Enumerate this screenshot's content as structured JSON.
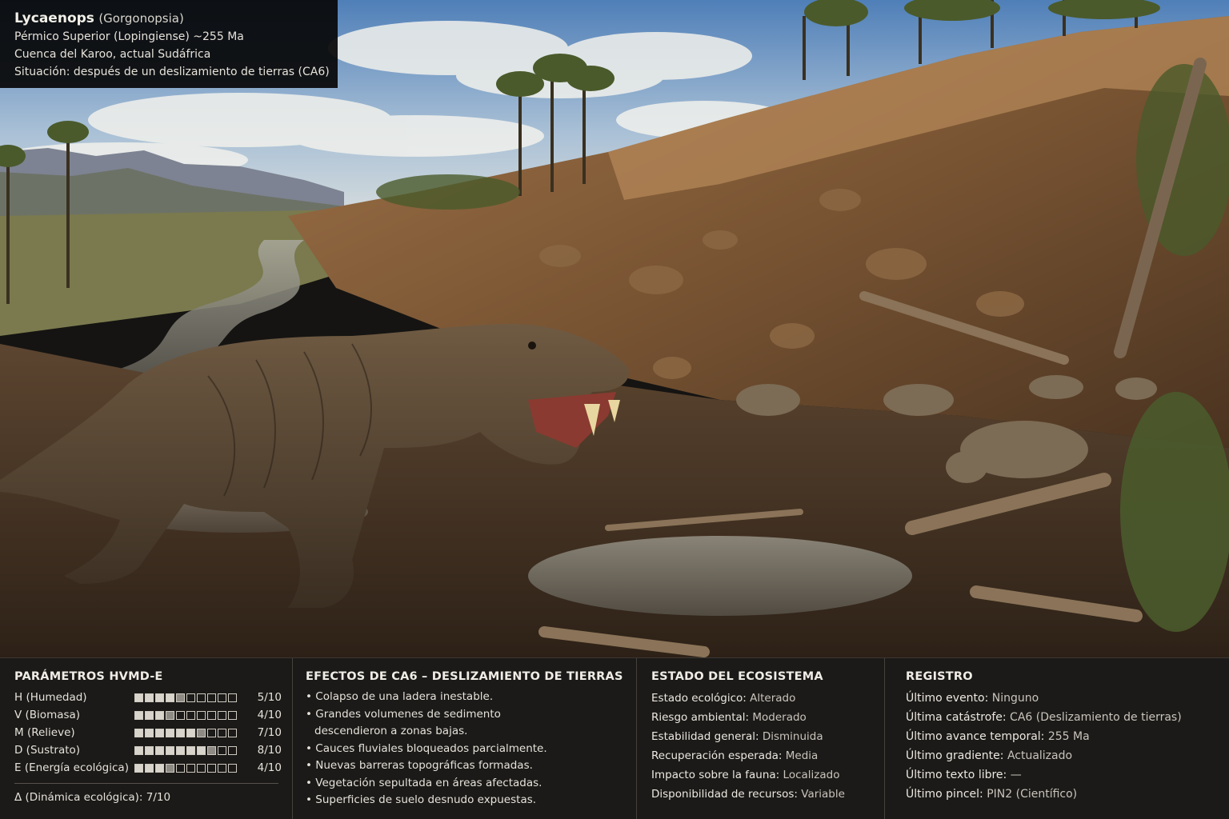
{
  "scene": {
    "colors": {
      "sky_top": "#5d89bf",
      "sky_low": "#c9d6e0",
      "earth": "#6a4a2e",
      "mud": "#3b2b1d",
      "vegetation": "#4b5a2a",
      "water": "#8c8a80"
    }
  },
  "info": {
    "name": "Lycaenops",
    "group": "(Gorgonopsia)",
    "period": "Pérmico Superior (Lopingiense) ~255 Ma",
    "location": "Cuenca del Karoo, actual Sudáfrica",
    "situation": "Situación: después de un deslizamiento de tierras (CA6)"
  },
  "params": {
    "title": "PARÁMETROS HVMD-E",
    "rows": [
      {
        "label": "H (Humedad)",
        "level": 5,
        "value": "5/10"
      },
      {
        "label": "V (Biomasa)",
        "level": 4,
        "value": "4/10"
      },
      {
        "label": "M (Relieve)",
        "level": 7,
        "value": "7/10"
      },
      {
        "label": "D (Sustrato)",
        "level": 8,
        "value": "8/10"
      },
      {
        "label": "E (Energía ecológica)",
        "level": 4,
        "value": "4/10"
      }
    ],
    "delta": "Δ (Dinámica ecológica): 7/10"
  },
  "effects": {
    "title": "EFECTOS DE CA6 – DESLIZAMIENTO DE TIERRAS",
    "items": [
      "Colapso de una ladera inestable.",
      "Grandes volumenes de sedimento\ndescendieron a zonas bajas.",
      "Cauces fluviales bloqueados parcialmente.",
      "Nuevas barreras topográficas formadas.",
      "Vegetación sepultada en áreas afectadas.",
      "Superficies de suelo desnudo expuestas."
    ]
  },
  "ecosystem": {
    "title": "ESTADO DEL ECOSISTEMA",
    "rows": [
      {
        "k": "Estado ecológico:",
        "v": "Alterado"
      },
      {
        "k": "Riesgo ambiental:",
        "v": "Moderado"
      },
      {
        "k": "Estabilidad general:",
        "v": "Disminuida"
      },
      {
        "k": "Recuperación esperada:",
        "v": "Media"
      },
      {
        "k": "Impacto sobre la fauna:",
        "v": "Localizado"
      },
      {
        "k": "Disponibilidad de recursos:",
        "v": "Variable"
      }
    ]
  },
  "log": {
    "title": "REGISTRO",
    "rows": [
      {
        "k": "Último evento:",
        "v": "Ninguno"
      },
      {
        "k": "Última catástrofe:",
        "v": "CA6 (Deslizamiento de tierras)"
      },
      {
        "k": "Último avance temporal:",
        "v": "255 Ma"
      },
      {
        "k": "Último gradiente:",
        "v": "Actualizado"
      },
      {
        "k": "Último texto libre:",
        "v": "—"
      },
      {
        "k": "Último pincel:",
        "v": "PIN2 (Científico)"
      }
    ]
  }
}
